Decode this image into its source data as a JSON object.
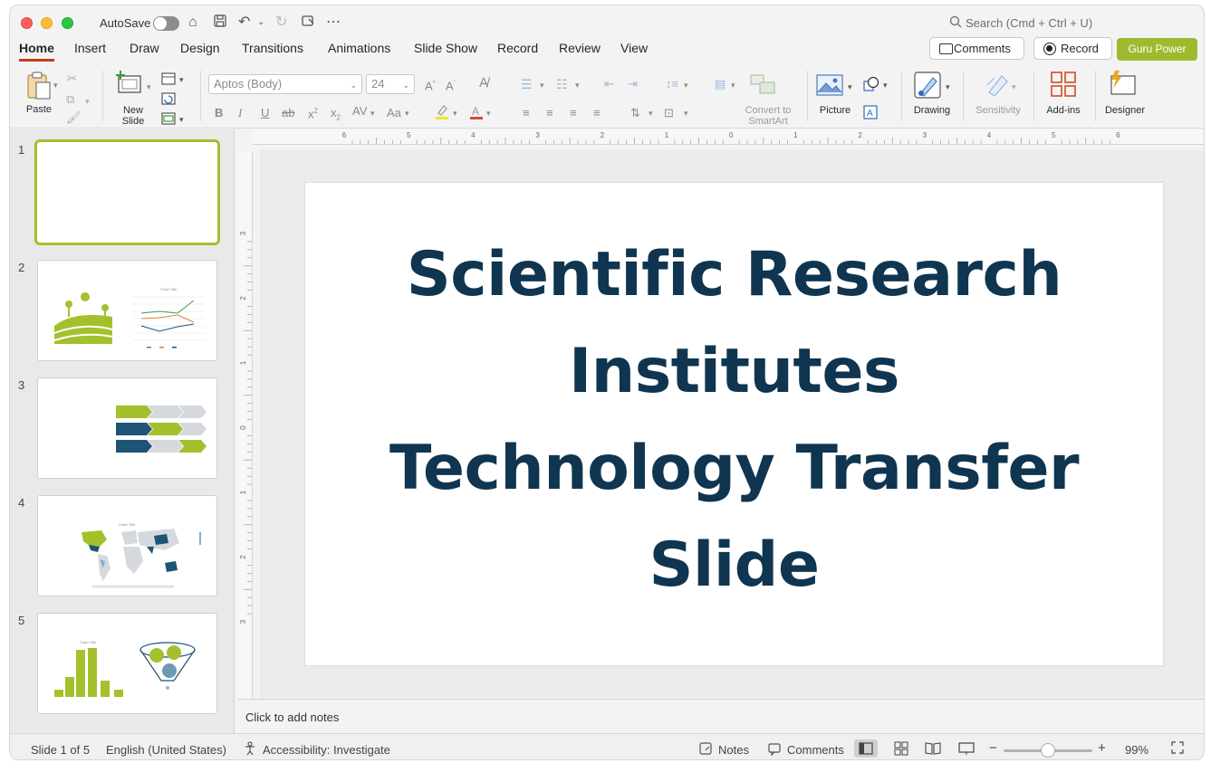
{
  "titlebar": {
    "autosave_label": "AutoSave",
    "search_placeholder": "Search (Cmd + Ctrl + U)"
  },
  "menu": {
    "tabs": [
      "Home",
      "Insert",
      "Draw",
      "Design",
      "Transitions",
      "Animations",
      "Slide Show",
      "Record",
      "Review",
      "View"
    ],
    "active_tab": "Home",
    "comments_label": "Comments",
    "record_label": "Record",
    "guru_label": "Guru Power"
  },
  "ribbon": {
    "paste": "Paste",
    "new_slide": "New\nSlide",
    "font_name": "Aptos (Body)",
    "font_size": "24",
    "convert_smartart": "Convert to\nSmartArt",
    "picture": "Picture",
    "drawing": "Drawing",
    "sensitivity": "Sensitivity",
    "addins": "Add-ins",
    "designer": "Designer"
  },
  "slides": {
    "numbers": [
      "1",
      "2",
      "3",
      "4",
      "5"
    ],
    "thumb2_chart_title": "Chart Title",
    "thumb4_chart_title": "Chart Title",
    "thumb5_chart_title": "Chart Title"
  },
  "slide": {
    "title_lines": [
      "Scientific Research",
      "Institutes",
      "Technology Transfer",
      "Slide"
    ]
  },
  "notes": {
    "placeholder": "Click to add notes"
  },
  "status": {
    "slide_of": "Slide 1 of 5",
    "language": "English (United States)",
    "accessibility": "Accessibility: Investigate",
    "notes": "Notes",
    "comments": "Comments",
    "zoom": "99%"
  },
  "colors": {
    "accent": "#c43e1c",
    "brand_green": "#9ebb2f",
    "title_navy": "#0f3550",
    "thumb_selected": "#a7bd2f"
  },
  "rulers": {
    "horizontal": [
      "6",
      "5",
      "4",
      "3",
      "2",
      "1",
      "0",
      "1",
      "2",
      "3",
      "4",
      "5",
      "6"
    ],
    "vertical": [
      "3",
      "2",
      "1",
      "0",
      "1",
      "2",
      "3"
    ]
  }
}
